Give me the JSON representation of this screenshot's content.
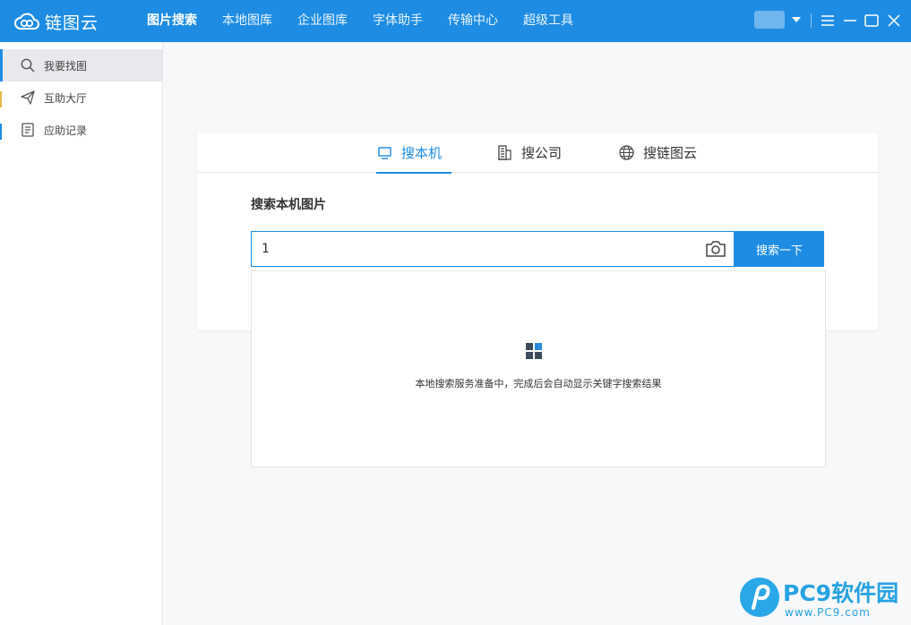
{
  "app": {
    "name": "链图云"
  },
  "nav": {
    "items": [
      {
        "label": "图片搜索",
        "active": true
      },
      {
        "label": "本地图库",
        "active": false
      },
      {
        "label": "企业图库",
        "active": false
      },
      {
        "label": "字体助手",
        "active": false
      },
      {
        "label": "传输中心",
        "active": false
      },
      {
        "label": "超级工具",
        "active": false
      }
    ]
  },
  "sidebar": {
    "items": [
      {
        "label": "我要找图",
        "icon": "search-icon",
        "active": true
      },
      {
        "label": "互助大厅",
        "icon": "send-icon",
        "active": false
      },
      {
        "label": "应助记录",
        "icon": "document-icon",
        "active": false
      }
    ]
  },
  "search": {
    "tabs": [
      {
        "label": "搜本机",
        "icon": "monitor-icon",
        "active": true
      },
      {
        "label": "搜公司",
        "icon": "building-icon",
        "active": false
      },
      {
        "label": "搜链图云",
        "icon": "globe-icon",
        "active": false
      }
    ],
    "section_title": "搜索本机图片",
    "input_value": "1",
    "button_label": "搜索一下",
    "status_message": "本地搜索服务准备中，完成后会自动显示关键字搜索结果"
  },
  "watermark": {
    "brand": "PC9软件园",
    "url": "www.PC9.com"
  },
  "colors": {
    "accent": "#1e8ce3",
    "background": "#f7f8fa"
  }
}
